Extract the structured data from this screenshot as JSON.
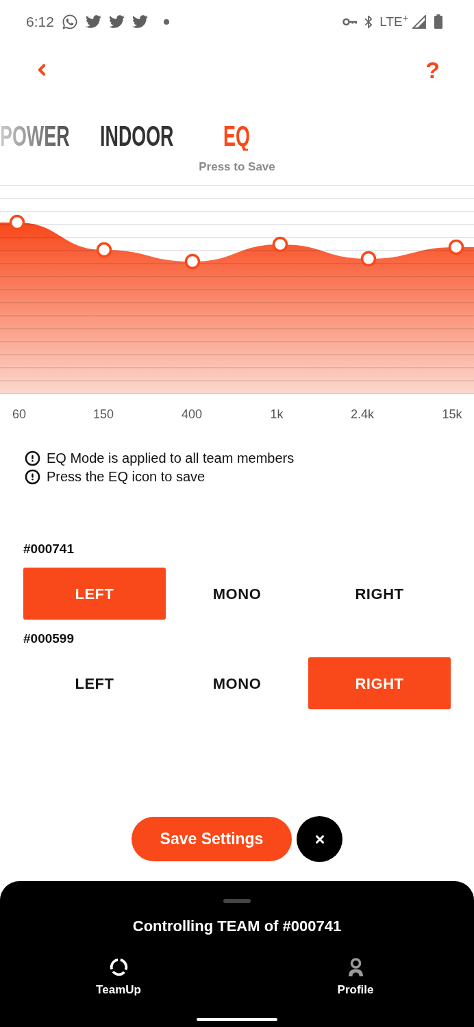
{
  "status_bar": {
    "time": "6:12",
    "network": "LTE$^{+}$"
  },
  "header": {
    "help": "?"
  },
  "tabs": [
    {
      "label": "POWER",
      "selected": false
    },
    {
      "label": "INDOOR",
      "selected": false
    },
    {
      "label": "EQ",
      "selected": true
    }
  ],
  "tab_hint": "Press to Save",
  "eq_chart": {
    "frequency_labels": [
      "60",
      "150",
      "400",
      "1k",
      "2.4k",
      "15k"
    ]
  },
  "notes": [
    "EQ Mode is applied to all team members",
    "Press the EQ icon to save"
  ],
  "devices": [
    {
      "id_label": "#000741",
      "options": [
        {
          "label": "LEFT",
          "selected": true
        },
        {
          "label": "MONO",
          "selected": false
        },
        {
          "label": "RIGHT",
          "selected": false
        }
      ]
    },
    {
      "id_label": "#000599",
      "options": [
        {
          "label": "LEFT",
          "selected": false
        },
        {
          "label": "MONO",
          "selected": false
        },
        {
          "label": "RIGHT",
          "selected": true
        }
      ]
    }
  ],
  "actions": {
    "save": "Save Settings"
  },
  "bottom_sheet": {
    "title": "Controlling TEAM of #000741",
    "nav": [
      {
        "label": "TeamUp",
        "selected": true
      },
      {
        "label": "Profile",
        "selected": false
      }
    ]
  }
}
